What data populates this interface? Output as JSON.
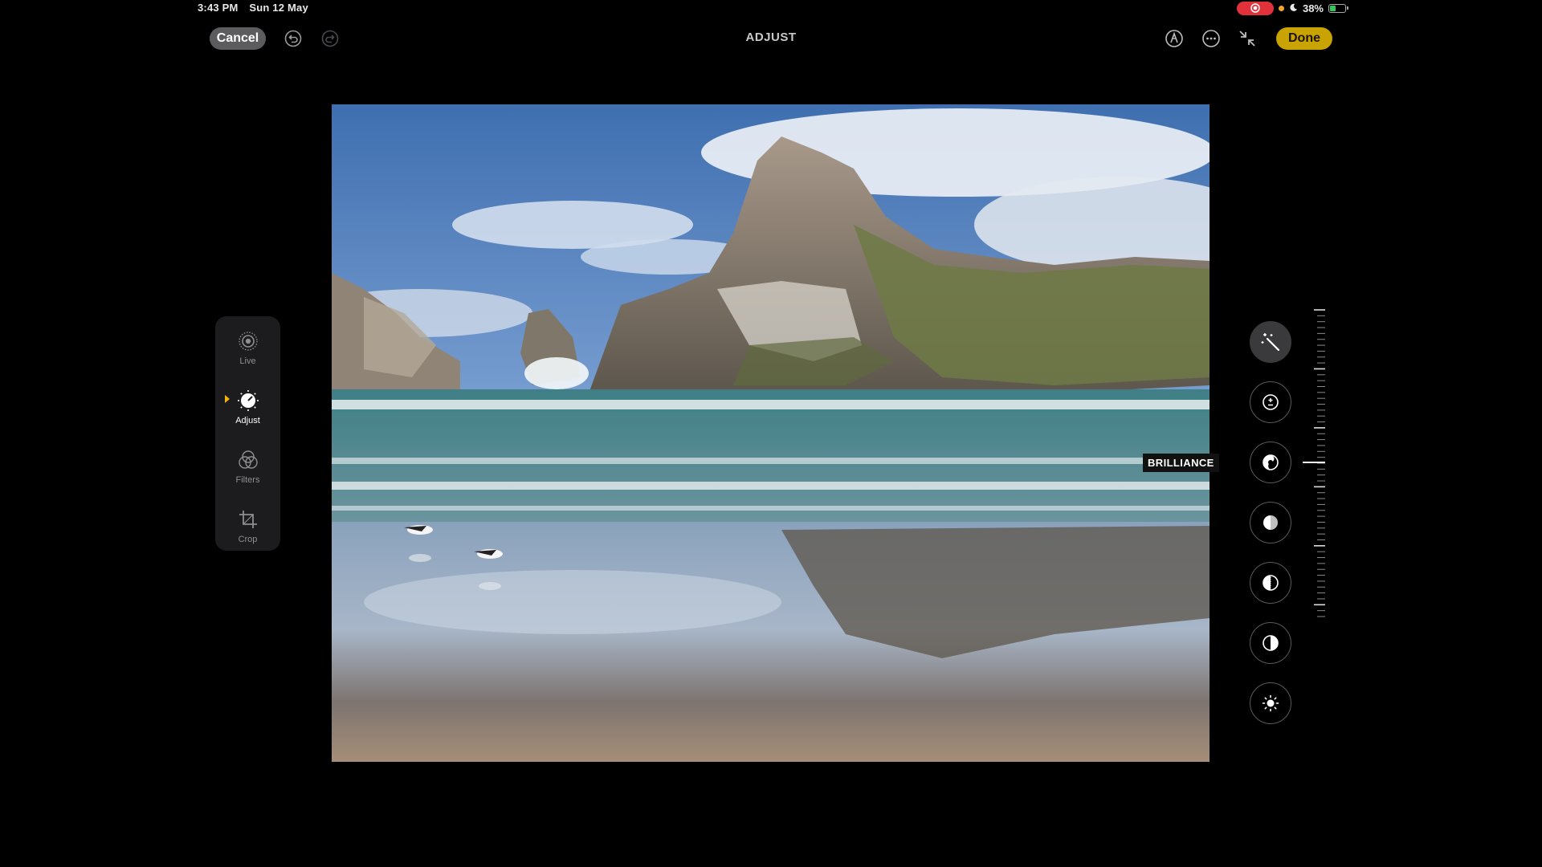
{
  "status": {
    "time": "3:43 PM",
    "date": "Sun 12 May",
    "battery": "38%",
    "battery_level": 0.38
  },
  "toolbar": {
    "cancel_label": "Cancel",
    "title": "ADJUST",
    "done_label": "Done"
  },
  "sidebar": {
    "items": [
      {
        "label": "Live",
        "icon": "live-photo-icon"
      },
      {
        "label": "Adjust",
        "icon": "adjust-dial-icon",
        "active": true
      },
      {
        "label": "Filters",
        "icon": "filters-icon"
      },
      {
        "label": "Crop",
        "icon": "crop-icon"
      }
    ]
  },
  "tools": {
    "selected_label": "BRILLIANCE",
    "items": [
      {
        "icon": "auto-enhance-wand-icon"
      },
      {
        "icon": "exposure-icon"
      },
      {
        "icon": "brilliance-icon"
      },
      {
        "icon": "highlights-icon"
      },
      {
        "icon": "shadows-icon"
      },
      {
        "icon": "contrast-icon"
      },
      {
        "icon": "brightness-icon"
      }
    ]
  },
  "colors": {
    "accent": "#c9a400",
    "cancel_bg": "#5c5c5e",
    "record": "#e1323c"
  }
}
